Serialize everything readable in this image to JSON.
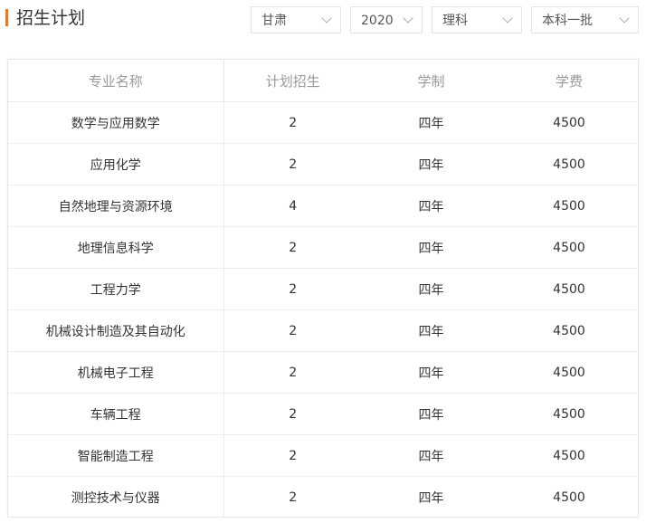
{
  "header": {
    "title": "招生计划"
  },
  "filters": {
    "province": "甘肃",
    "year": "2020",
    "subject": "理科",
    "batch": "本科一批"
  },
  "table": {
    "columns": [
      "专业名称",
      "计划招生",
      "学制",
      "学费"
    ],
    "rows": [
      {
        "major": "数学与应用数学",
        "plan": "2",
        "duration": "四年",
        "tuition": "4500"
      },
      {
        "major": "应用化学",
        "plan": "2",
        "duration": "四年",
        "tuition": "4500"
      },
      {
        "major": "自然地理与资源环境",
        "plan": "4",
        "duration": "四年",
        "tuition": "4500"
      },
      {
        "major": "地理信息科学",
        "plan": "2",
        "duration": "四年",
        "tuition": "4500"
      },
      {
        "major": "工程力学",
        "plan": "2",
        "duration": "四年",
        "tuition": "4500"
      },
      {
        "major": "机械设计制造及其自动化",
        "plan": "2",
        "duration": "四年",
        "tuition": "4500"
      },
      {
        "major": "机械电子工程",
        "plan": "2",
        "duration": "四年",
        "tuition": "4500"
      },
      {
        "major": "车辆工程",
        "plan": "2",
        "duration": "四年",
        "tuition": "4500"
      },
      {
        "major": "智能制造工程",
        "plan": "2",
        "duration": "四年",
        "tuition": "4500"
      },
      {
        "major": "测控技术与仪器",
        "plan": "2",
        "duration": "四年",
        "tuition": "4500"
      }
    ]
  },
  "colors": {
    "accent": "#e8772e",
    "header_text": "#999999",
    "body_text": "#333333",
    "border": "#e6e6e6"
  }
}
